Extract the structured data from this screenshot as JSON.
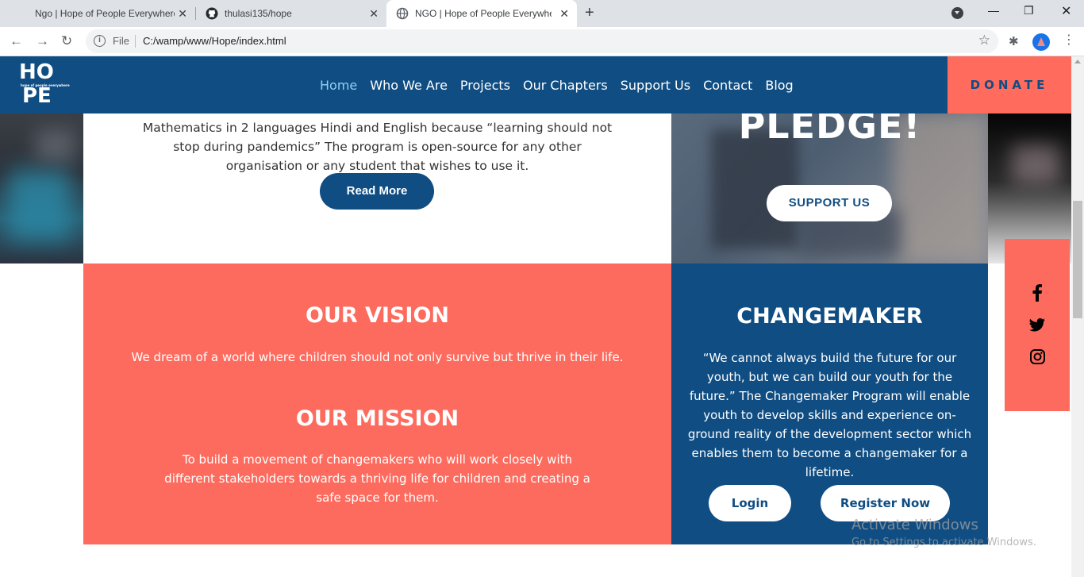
{
  "browser": {
    "tabs": [
      {
        "title": "Ngo | Hope of People Everywhere",
        "icon": "blank-page-icon"
      },
      {
        "title": "thulasi135/hope",
        "icon": "github-icon"
      },
      {
        "title": "NGO | Hope of People Everywhere",
        "icon": "globe-icon"
      }
    ],
    "new_tab": "+",
    "scheme_label": "File",
    "url": "C:/wamp/www/Hope/index.html"
  },
  "site": {
    "logo": {
      "line1": "HO",
      "tagline": "hope of people everywhere",
      "line2": "PE"
    },
    "nav": [
      "Home",
      "Who We Are",
      "Projects",
      "Our Chapters",
      "Support Us",
      "Contact",
      "Blog"
    ],
    "active_nav": "Home",
    "donate": "DONATE"
  },
  "project": {
    "text": "Mathematics in 2 languages Hindi and English because “learning should not stop during pandemics” The program is open-source for any other organisation or any student that wishes to use it.",
    "read_more": "Read More"
  },
  "pledge": {
    "heading": "PLEDGE!",
    "button": "SUPPORT US"
  },
  "vision": {
    "heading": "OUR VISION",
    "text": "We dream of a world where children should not only survive but thrive in their life."
  },
  "mission": {
    "heading": "OUR MISSION",
    "text": "To build a movement of changemakers who will work closely with different stakeholders towards a thriving life for children and creating a safe space for them."
  },
  "changemaker": {
    "heading": "CHANGEMAKER",
    "text": "“We cannot always build the future for our youth, but we can build our youth for the future.” The Changemaker Program will enable youth to develop skills and experience on-ground reality of the development sector which enables them to become a changemaker for a lifetime.",
    "login": "Login",
    "register": "Register Now"
  },
  "social": [
    "facebook-icon",
    "twitter-icon",
    "instagram-icon"
  ],
  "watermark": {
    "line1": "Activate Windows",
    "line2": "Go to Settings to activate Windows."
  },
  "colors": {
    "navy": "#104d82",
    "coral": "#fd6b5e",
    "active_link": "#8fd0f5"
  }
}
